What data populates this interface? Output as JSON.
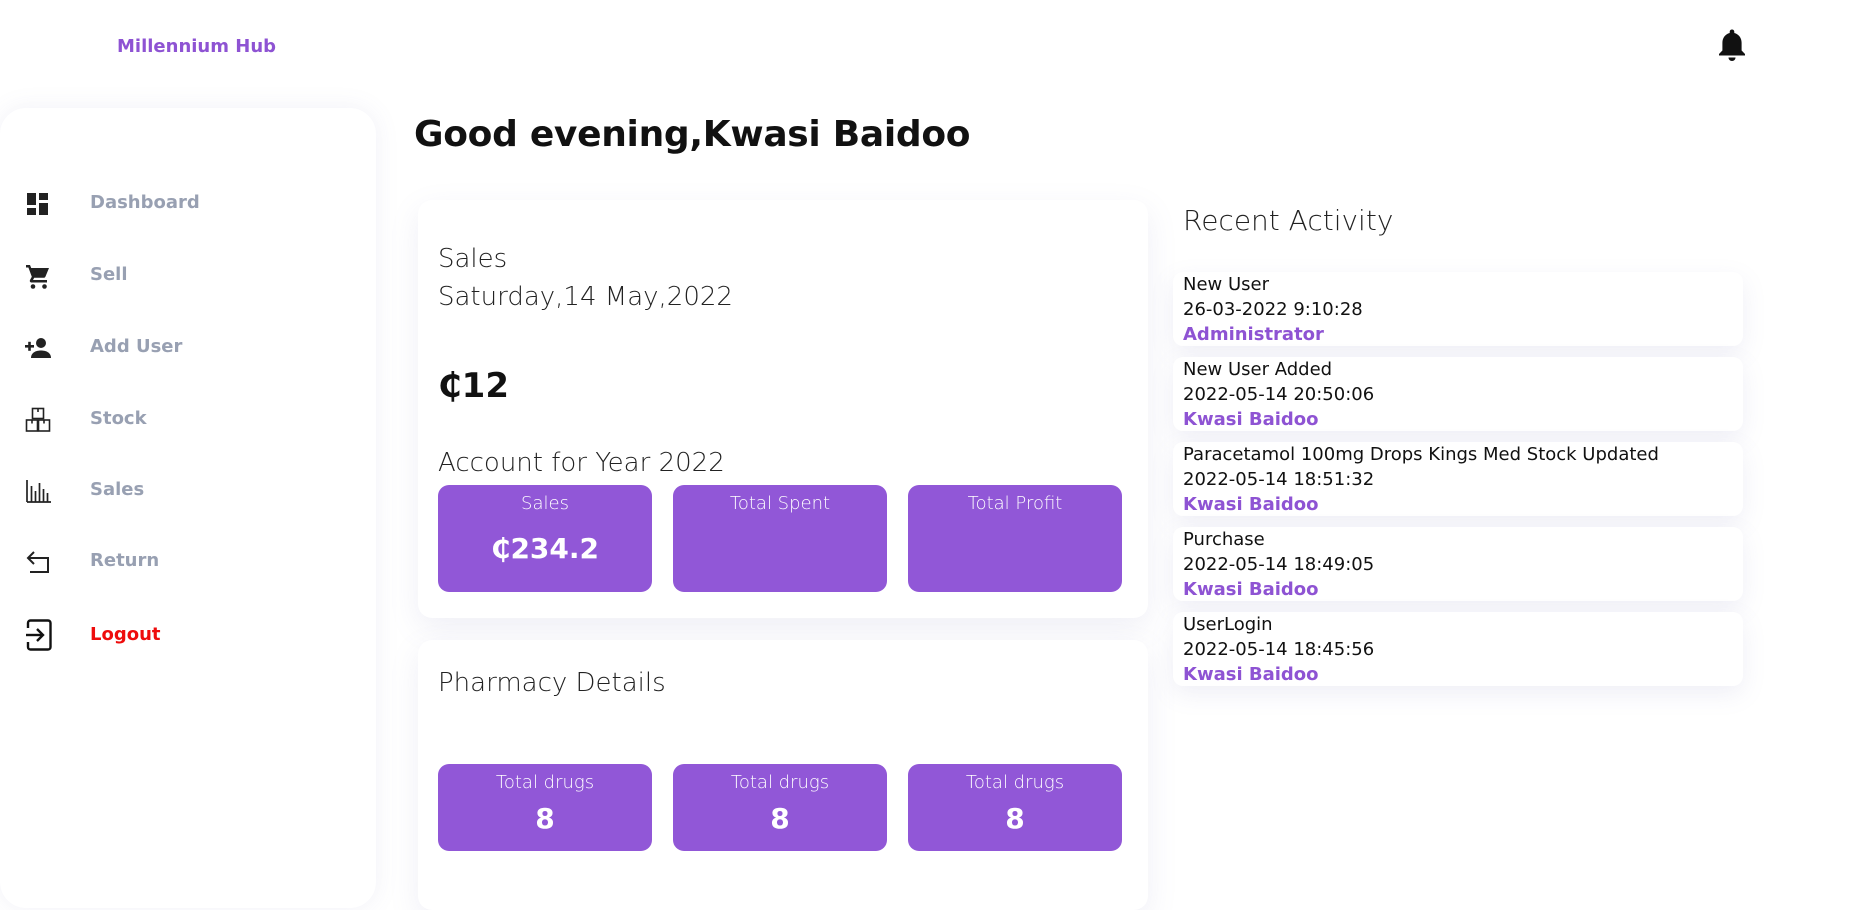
{
  "header": {
    "brand": "Millennium Hub",
    "notification_icon": "bell-icon"
  },
  "sidebar": {
    "items": [
      {
        "label": "Dashboard",
        "icon": "dashboard-icon"
      },
      {
        "label": "Sell",
        "icon": "cart-icon"
      },
      {
        "label": "Add User",
        "icon": "add-user-icon"
      },
      {
        "label": "Stock",
        "icon": "boxes-icon"
      },
      {
        "label": "Sales",
        "icon": "bar-chart-icon"
      },
      {
        "label": "Return",
        "icon": "return-icon"
      },
      {
        "label": "Logout",
        "icon": "logout-icon"
      }
    ],
    "logout_color": "#ee0c0c"
  },
  "greeting": "Good evening,Kwasi Baidoo",
  "sales_card": {
    "title": "Sales",
    "date": "Saturday,14 May,2022",
    "amount": "₵12",
    "account_title": "Account for Year 2022",
    "tiles": [
      {
        "label": "Sales",
        "value": "₵234.2"
      },
      {
        "label": "Total Spent",
        "value": ""
      },
      {
        "label": "Total Profit",
        "value": ""
      }
    ]
  },
  "pharmacy_card": {
    "title": "Pharmacy Details",
    "tiles": [
      {
        "label": "Total drugs",
        "value": "8"
      },
      {
        "label": "Total drugs",
        "value": "8"
      },
      {
        "label": "Total drugs",
        "value": "8"
      }
    ]
  },
  "activity": {
    "title": "Recent Activity",
    "items": [
      {
        "title": "New User",
        "time": "26-03-2022 9:10:28",
        "user": "Administrator"
      },
      {
        "title": "New User Added",
        "time": "2022-05-14 20:50:06",
        "user": "Kwasi Baidoo"
      },
      {
        "title": "Paracetamol 100mg Drops Kings Med Stock Updated",
        "time": "2022-05-14 18:51:32",
        "user": "Kwasi Baidoo"
      },
      {
        "title": "Purchase",
        "time": "2022-05-14 18:49:05",
        "user": "Kwasi Baidoo"
      },
      {
        "title": "UserLogin",
        "time": "2022-05-14 18:45:56",
        "user": "Kwasi Baidoo"
      }
    ]
  },
  "colors": {
    "accent": "#9157d7",
    "brand": "#8e53d3",
    "nav_text": "#98a0b2"
  }
}
